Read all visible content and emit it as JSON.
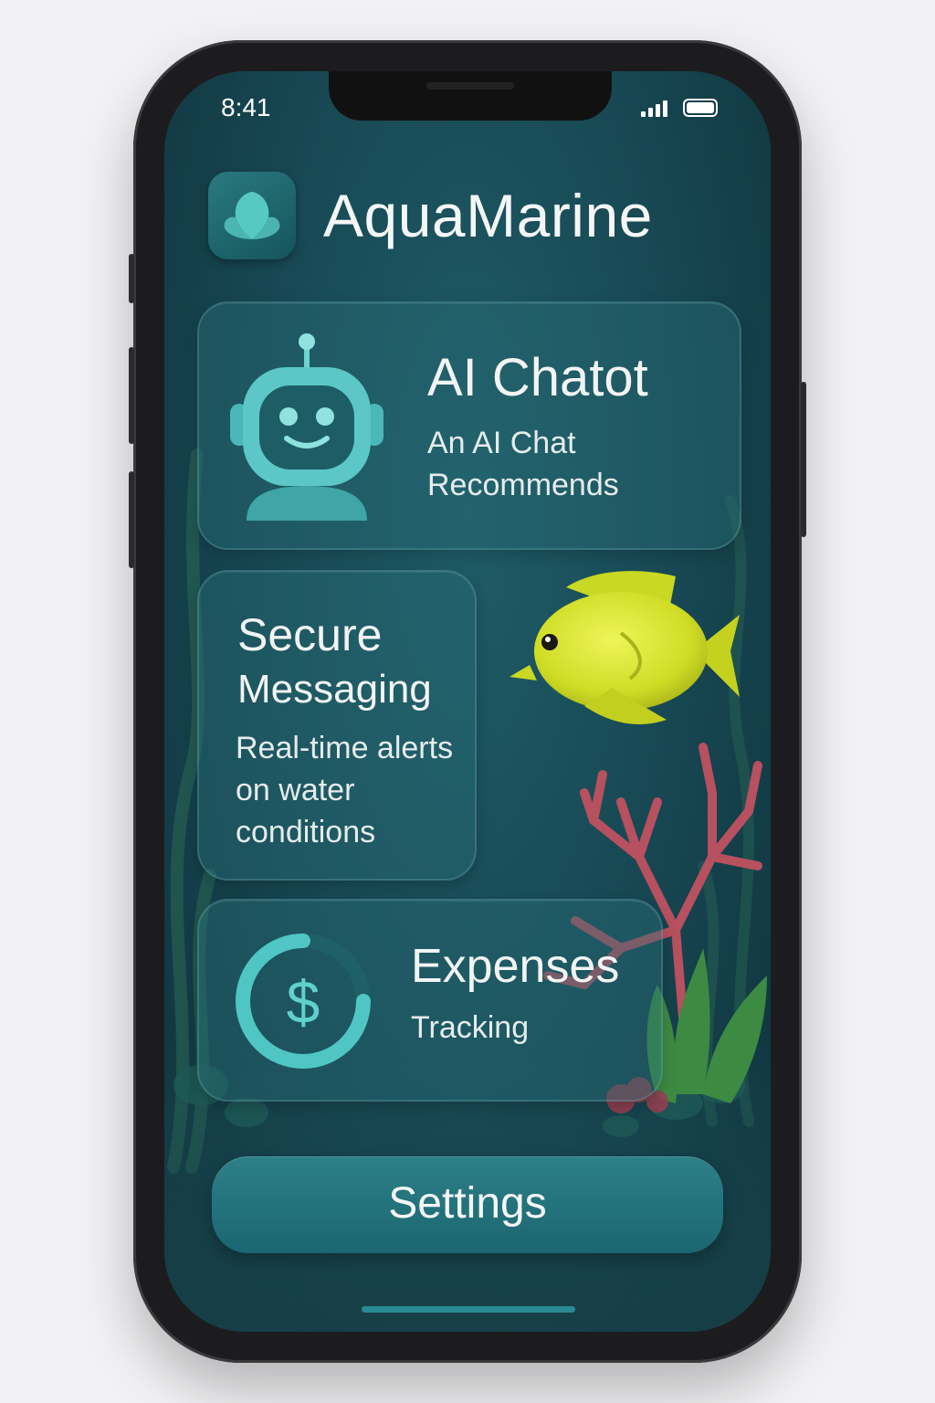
{
  "status_bar": {
    "time": "8:41"
  },
  "app": {
    "title": "AquaMarine",
    "icon": "shell-icon"
  },
  "cards": {
    "chatbot": {
      "title": "AI Chatot",
      "subtitle_line1": "An AI Chat",
      "subtitle_line2": "Recommends",
      "icon": "robot-icon"
    },
    "messaging": {
      "title_line1": "Secure",
      "title_line2": "Messaging",
      "subtitle_line1": "Real-time alerts",
      "subtitle_line2": "on water",
      "subtitle_line3": "conditions"
    },
    "expenses": {
      "title": "Expenses",
      "subtitle": "Tracking",
      "icon": "dollar-ring-icon"
    }
  },
  "settings": {
    "label": "Settings"
  },
  "colors": {
    "accent": "#4fc6c4",
    "fish": "#d8e62c",
    "coral": "#b7505f",
    "background": "#184a55"
  }
}
